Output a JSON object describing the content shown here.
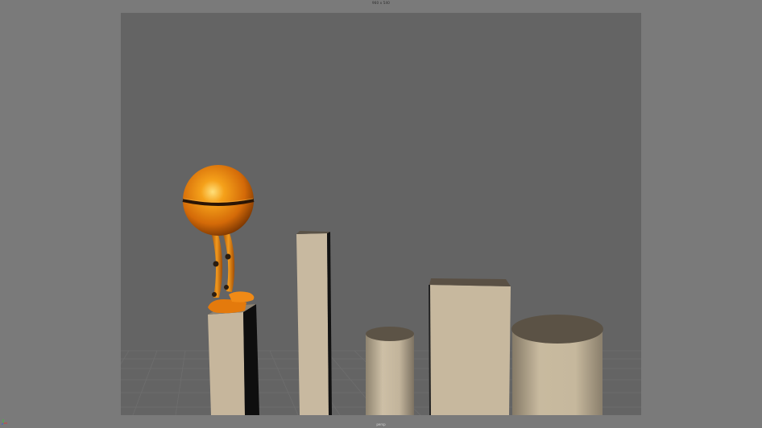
{
  "viewport": {
    "resolution_label": "960 x 540",
    "camera_label": "persp"
  },
  "scene": {
    "background_color": "#646464",
    "outer_background_color": "#7a7a7a",
    "character_color": "#e07a10",
    "prop_color": "#c4b49a",
    "objects": [
      "robot-character",
      "box-pillar-1",
      "box-pillar-2",
      "cylinder-1",
      "box-pillar-3",
      "cylinder-2"
    ]
  }
}
